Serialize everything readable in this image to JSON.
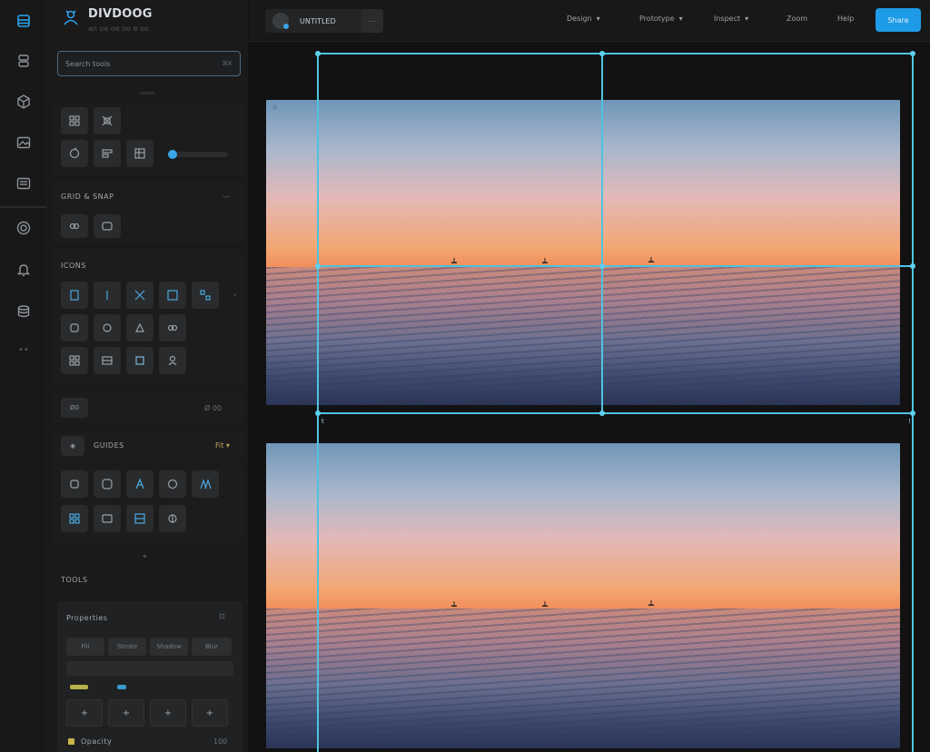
{
  "app": {
    "brand_title": "DIVDOOG",
    "brand_subtitle": "an oe oe oo e oo"
  },
  "rail": {
    "items": [
      {
        "name": "layers-icon"
      },
      {
        "name": "stack-icon"
      },
      {
        "name": "cube-icon"
      },
      {
        "name": "image-icon"
      },
      {
        "name": "text-block-icon"
      },
      {
        "name": "target-icon"
      },
      {
        "name": "bell-icon"
      },
      {
        "name": "database-icon"
      }
    ],
    "more_label": "••"
  },
  "panel": {
    "search_placeholder": "Search tools",
    "search_shortcut": "⌘K",
    "section2_label": "GRID & SNAP",
    "section2_right": "—",
    "section3_label": "ICONS",
    "section4_chip": "Ø0",
    "section4_right": "Ø 00",
    "section5_label": "GUIDES",
    "section5_right": "Fit ▾",
    "section6_label": "TOOLS",
    "card_title": "Properties",
    "card_icon": "⊡",
    "card_segments": [
      "Fill",
      "Stroke",
      "Shadow",
      "Blur"
    ],
    "card_cells": [
      "+",
      "+",
      "+",
      "+"
    ],
    "footer_label": "Opacity",
    "footer_value": "100"
  },
  "topbar": {
    "doc_name": "UNTITLED",
    "doc_extra": "⋯",
    "menus": [
      "Design",
      "Prototype",
      "Inspect"
    ],
    "menu_plain": [
      "Zoom",
      "Help"
    ],
    "share_label": "Share"
  },
  "canvas": {
    "top_frame_marker": "☼",
    "sel_label_left": "t",
    "sel_label_right": "!"
  },
  "colors": {
    "accent": "#1e9be6",
    "guide": "#4fc3e0",
    "background": "#141414"
  }
}
